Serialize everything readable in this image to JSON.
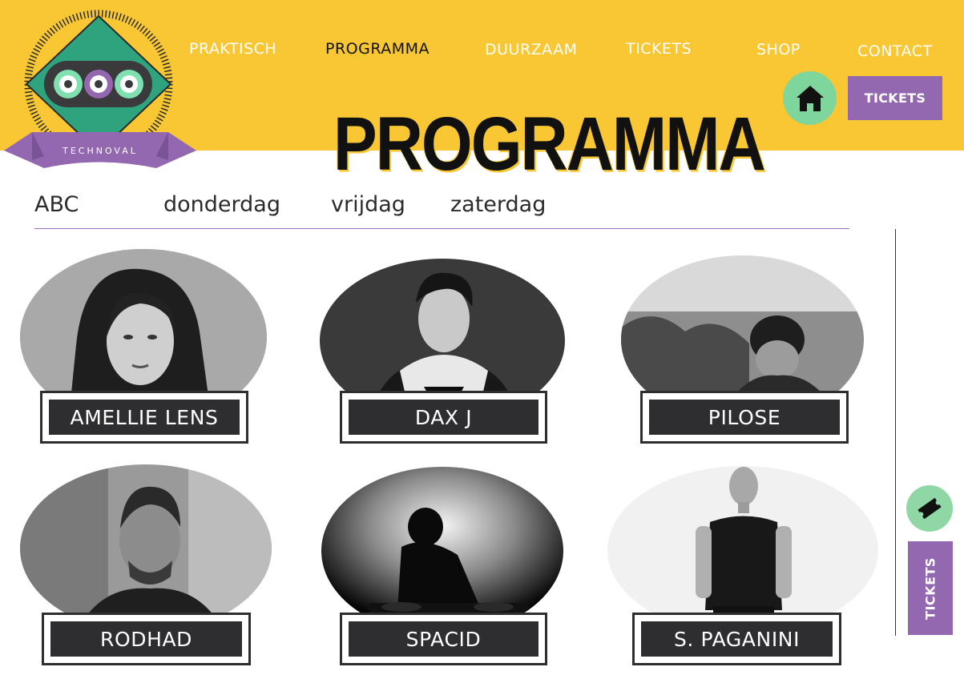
{
  "brand": {
    "logo_text": "TECHNOVAL"
  },
  "nav": {
    "items": [
      "PRAKTISCH",
      "PROGRAMMA",
      "DUURZAAM",
      "TICKETS",
      "SHOP",
      "CONTACT"
    ],
    "active": "PROGRAMMA",
    "home_icon": "home-icon",
    "tickets_button": "TICKETS"
  },
  "page": {
    "title": "PROGRAMMA"
  },
  "day_tabs": [
    "ABC",
    "donderdag",
    "vrijdag",
    "zaterdag"
  ],
  "artists": [
    {
      "name": "AMELLIE LENS"
    },
    {
      "name": "DAX J"
    },
    {
      "name": "PILOSE"
    },
    {
      "name": "RODHAD"
    },
    {
      "name": "SPACID"
    },
    {
      "name": "S. PAGANINI"
    }
  ],
  "side": {
    "ticket_icon": "ticket-icon",
    "tickets_label": "TICKETS"
  },
  "colors": {
    "header_yellow": "#f8c733",
    "accent_purple": "#9468b0",
    "accent_green": "#7fd69d",
    "nameplate_dark": "#2e2e30"
  }
}
